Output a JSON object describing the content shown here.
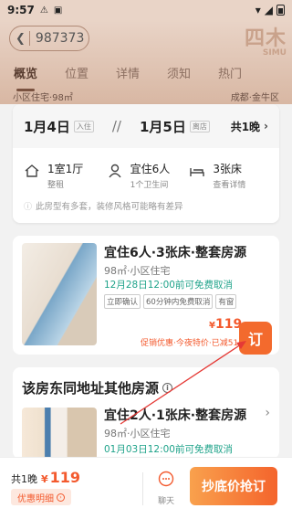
{
  "status": {
    "time": "9:57"
  },
  "header": {
    "listing_id": "987373",
    "logo_cn": "四木",
    "logo_en": "SIMU",
    "tabs": [
      "概览",
      "位置",
      "详情",
      "须知",
      "热门"
    ],
    "peek_left": "小区住宅·98㎡",
    "peek_right": "成都·金牛区"
  },
  "dates": {
    "checkin": "1月4日",
    "checkin_tag": "入住",
    "checkout": "1月5日",
    "checkout_tag": "离店",
    "separator": "//",
    "nights": "共1晚",
    "features": [
      {
        "title": "1室1厅",
        "sub": "整租"
      },
      {
        "title": "宜住6人",
        "sub": "1个卫生间"
      },
      {
        "title": "3张床",
        "sub": "查看详情"
      }
    ],
    "note": "此房型有多套，装修风格可能略有差异"
  },
  "room": {
    "title": "宜住6人·3张床·整套房源",
    "sub": "98㎡·小区住宅",
    "cancel": "12月28日12:00前可免费取消",
    "chips": [
      "立即确认",
      "60分钟内免费取消",
      "有窗"
    ],
    "currency": "¥",
    "price": "119",
    "promo": "促销优惠·今夜特价·已减51",
    "book_label": "订"
  },
  "other": {
    "heading": "该房东同地址其他房源",
    "title": "宜住2人·1张床·整套房源",
    "sub": "98㎡·小区住宅",
    "cancel": "01月03日12:00前可免费取消"
  },
  "bottom": {
    "total_prefix": "共1晚",
    "currency": "¥",
    "total": "119",
    "detail_label": "优惠明细",
    "chat_label": "聊天",
    "cta_label": "抄底价抢订"
  },
  "colors": {
    "accent": "#f35a2e",
    "green": "#1fa38a",
    "header": "#e9d4c7"
  }
}
